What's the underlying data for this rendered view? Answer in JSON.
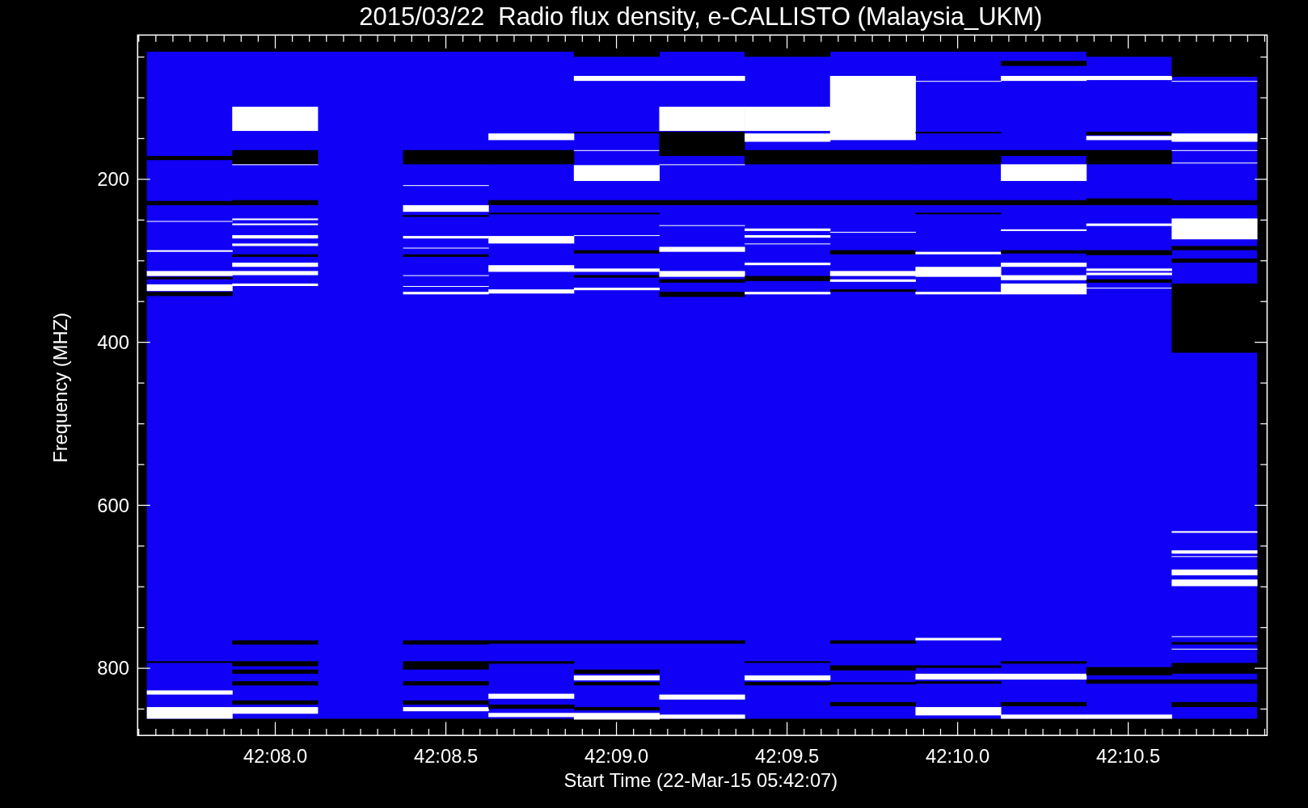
{
  "title": "2015/03/22  Radio flux density, e-CALLISTO (Malaysia_UKM)",
  "y_axis": {
    "label": "Frequency (MHZ)",
    "ticks": [
      "200",
      "400",
      "600",
      "800"
    ]
  },
  "x_axis": {
    "label": "Start Time (22-Mar-15 05:42:07)",
    "ticks": [
      "42:08.0",
      "42:08.5",
      "42:09.0",
      "42:09.5",
      "42:10.0",
      "42:10.5"
    ]
  }
}
